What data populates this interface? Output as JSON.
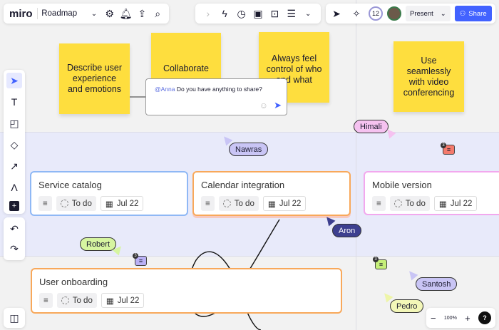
{
  "header": {
    "logo": "miro",
    "board_name": "Roadmap",
    "collaborator_count": "12",
    "present_label": "Present",
    "share_label": "Share"
  },
  "stickies": [
    "Describe user experience and emotions",
    "Collaborate",
    "Always feel control of who and what",
    "Use seamlessly with video conferencing"
  ],
  "comment_box": {
    "mention": "@Anna",
    "text": "Do you have anything to share?"
  },
  "cards": [
    {
      "title": "Service catalog",
      "status": "To do",
      "date": "Jul 22"
    },
    {
      "title": "Calendar integration",
      "status": "To do",
      "date": "Jul 22"
    },
    {
      "title": "Mobile version",
      "status": "To do",
      "date": "Jul 22"
    },
    {
      "title": "User onboarding",
      "status": "To do",
      "date": "Jul 22"
    }
  ],
  "cursors": [
    "Nawras",
    "Himali",
    "Aron",
    "Robert",
    "Santosh",
    "Pedro"
  ],
  "comment_counts": [
    "3",
    "3",
    "3"
  ],
  "zoom": {
    "level": "100%",
    "minus": "−",
    "plus": "+",
    "help": "?"
  },
  "colors": {
    "accent": "#4262ff",
    "sticky": "#fede3e",
    "card_blue": "#8fb8f5",
    "card_orange": "#f8a85a",
    "card_pink": "#f2a8ee"
  }
}
